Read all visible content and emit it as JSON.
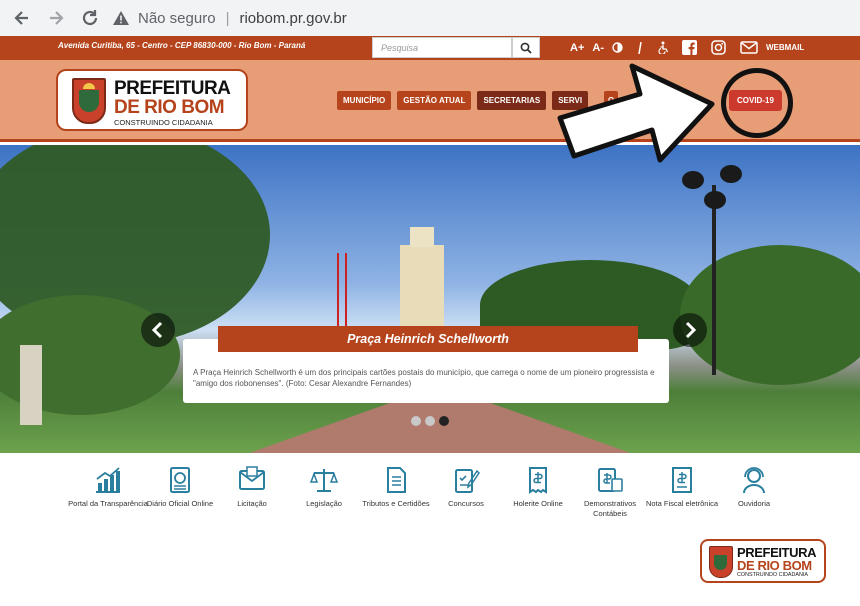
{
  "browser": {
    "warning_label": "Não seguro",
    "url": "riobom.pr.gov.br"
  },
  "topbar": {
    "address": "Avenida Curitiba, 65 - Centro - CEP 86830-000 - Rio Bom - Paraná",
    "search_placeholder": "Pesquisa",
    "font_plus": "A+",
    "font_minus": "A-",
    "webmail": "WEBMAIL"
  },
  "logo": {
    "line1": "PREFEITURA",
    "line2": "DE RIO BOM",
    "line3": "CONSTRUINDO CIDADANIA"
  },
  "menu": {
    "items": [
      "MUNICÍPIO",
      "GESTÃO ATUAL",
      "SECRETARIAS",
      "SERVI"
    ],
    "partial_item": "O",
    "covid": "COVID-19"
  },
  "banner": {
    "title": "Praça Heinrich Schellworth",
    "description": "A Praça Heinrich Schellworth é um dos principais cartões postais do município, que carrega o nome de um pioneiro progressista e \"amigo dos riobonenses\". (Foto: Cesar Alexandre Fernandes)",
    "slides_total": 3,
    "active_slide": 3
  },
  "services": [
    {
      "label": "Portal da Transparência"
    },
    {
      "label": "Diário Oficial Online"
    },
    {
      "label": "Licitação"
    },
    {
      "label": "Legislação"
    },
    {
      "label": "Tributos e Certidões"
    },
    {
      "label": "Concursos"
    },
    {
      "label": "Holerite Online"
    },
    {
      "label": "Demonstrativos Contábeis"
    },
    {
      "label": "Nota Fiscal eletrônica"
    },
    {
      "label": "Ouvidoria"
    }
  ],
  "colors": {
    "brand": "#b5441c",
    "header_bg": "#e79d76",
    "covid": "#cc3a2e",
    "icon": "#2a7f9e"
  }
}
